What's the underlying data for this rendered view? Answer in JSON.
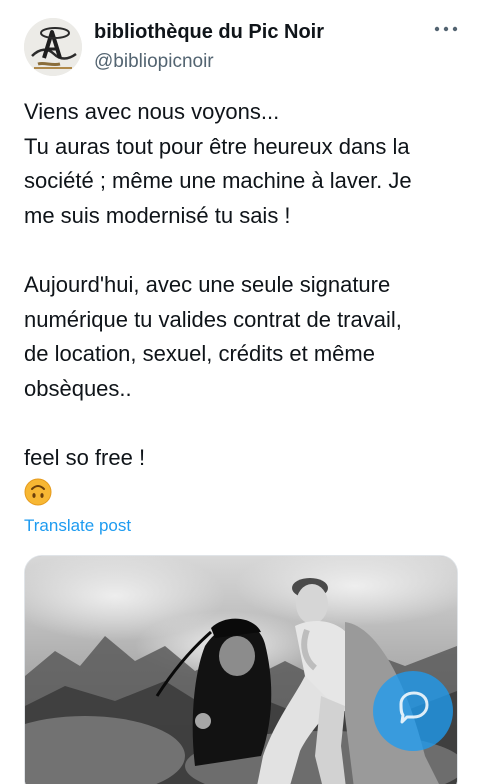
{
  "post": {
    "author": {
      "display_name": "bibliothèque du Pic Noir",
      "handle": "@bibliopicnoir"
    },
    "more_icon": "more-horizontal-icon",
    "text_lines": [
      "Viens avec nous voyons...",
      "Tu auras tout pour être heureux dans la",
      "société ; même une machine à laver. Je",
      "me suis modernisé tu sais !",
      "",
      "Aujourd'hui, avec une seule signature",
      "numérique tu valides contrat de travail,",
      "de location, sexuel, crédits et même",
      "obsèques..",
      "",
      "feel so free !"
    ],
    "emoji": "upside-down-face-emoji",
    "translate_label": "Translate post",
    "media": {
      "kind": "black-and-white film still"
    }
  },
  "floating_button": {
    "icon": "chat-bubble-icon"
  },
  "colors": {
    "text": "#0f1419",
    "secondary": "#536471",
    "link": "#1d9bf0",
    "fab": "#1d9bf0"
  }
}
